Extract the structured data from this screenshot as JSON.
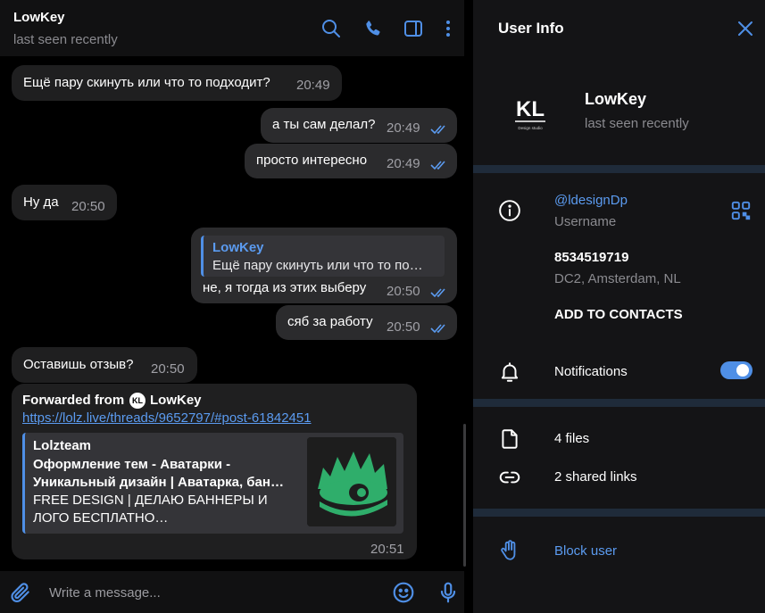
{
  "chat": {
    "contact_name": "LowKey",
    "contact_status": "last seen recently",
    "header_icons": [
      "search-icon",
      "phone-icon",
      "sidebar-icon",
      "more-vertical-icon"
    ],
    "messages": [
      {
        "direction": "in",
        "text": "Ещё пару скинуть или что то подходит?",
        "time": "20:49"
      },
      {
        "direction": "out",
        "text": "а ты сам делал?",
        "time": "20:49",
        "read": true
      },
      {
        "direction": "out",
        "text": "просто интересно",
        "time": "20:49",
        "read": true
      },
      {
        "direction": "in",
        "text": "Ну да",
        "time": "20:50"
      },
      {
        "direction": "out",
        "reply_name": "LowKey",
        "reply_text": "Ещё пару скинуть или что то по…",
        "text": "не, я тогда из этих выберу",
        "time": "20:50",
        "read": true
      },
      {
        "direction": "out",
        "text": "сяб за работу",
        "time": "20:50",
        "read": true
      },
      {
        "direction": "in",
        "text": "Оставишь отзыв?",
        "time": "20:50"
      },
      {
        "direction": "in",
        "forwarded_label": "Forwarded from",
        "forwarded_avatar": "KL",
        "forwarded_name": "LowKey",
        "link": "https://lolz.live/threads/9652797/#post-61842451",
        "preview": {
          "site": "Lolzteam",
          "title": "Оформление тем - Аватарки - Уникальный дизайн | Аватарка, бан…",
          "description": "FREE DESIGN | ДЕЛАЮ БАННЕРЫ И ЛОГО БЕСПЛАТНО…"
        },
        "time": "20:51"
      }
    ],
    "composer": {
      "placeholder": "Write a message...",
      "icons": [
        "paperclip-icon",
        "emoji-icon",
        "microphone-icon"
      ]
    }
  },
  "info": {
    "title": "User Info",
    "name": "LowKey",
    "status": "last seen recently",
    "logo_text": "KL",
    "logo_caption": "Design studio",
    "username": "@ldesignDp",
    "username_label": "Username",
    "phone": "8534519719",
    "phone_sub": "DC2, Amsterdam, NL",
    "add_contacts": "ADD TO CONTACTS",
    "notifications_label": "Notifications",
    "notifications_on": true,
    "files": "4 files",
    "links": "2 shared links",
    "block": "Block user"
  },
  "colors": {
    "accent": "#4f8fe6",
    "link": "#5b9bf0",
    "bubble_in": "#1f1f20",
    "bubble_out": "#2b2b2d",
    "panel": "#141416",
    "divider": "#1f2b3a"
  }
}
